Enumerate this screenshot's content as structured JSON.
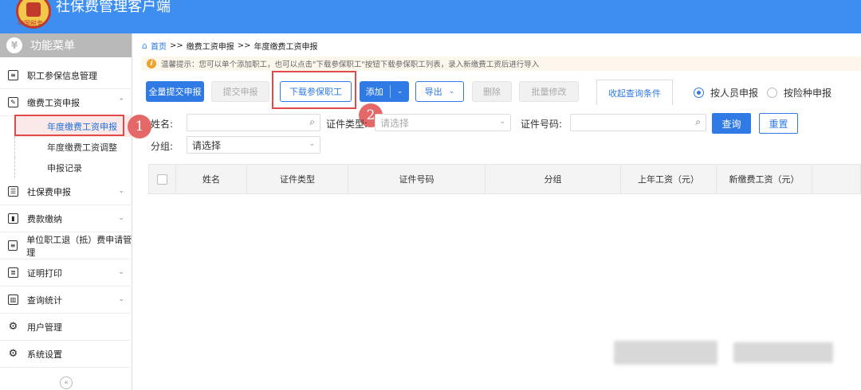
{
  "app": {
    "title": "社保费管理客户端",
    "logo_caption": "中国税务",
    "brand_color": "#3d8ef0"
  },
  "sidebar": {
    "header": "功能菜单",
    "header_icon": "yen-icon",
    "items": [
      {
        "label": "职工参保信息管理",
        "icon": "list-icon"
      },
      {
        "label": "缴费工资申报",
        "icon": "edit-icon",
        "expanded": true,
        "children": [
          {
            "label": "年度缴费工资申报",
            "active": true
          },
          {
            "label": "年度缴费工资调整"
          },
          {
            "label": "申报记录"
          }
        ]
      },
      {
        "label": "社保费申报",
        "icon": "form-icon"
      },
      {
        "label": "费款缴纳",
        "icon": "book-icon"
      },
      {
        "label": "单位职工退（抵）费申请管理",
        "icon": "list-icon"
      },
      {
        "label": "证明打印",
        "icon": "print-icon"
      },
      {
        "label": "查询统计",
        "icon": "chart-icon"
      },
      {
        "label": "用户管理",
        "icon": "gear-icon"
      },
      {
        "label": "系统设置",
        "icon": "gear-icon"
      }
    ],
    "collapse_label": "«"
  },
  "breadcrumb": {
    "home": "首页",
    "sep": ">>",
    "level1": "缴费工资申报",
    "level2": "年度缴费工资申报"
  },
  "tip": "温馨提示：您可以单个添加职工，也可以点击\"下载参保职工\"按钮下载参保职工列表，录入新缴费工资后进行导入",
  "toolbar": {
    "submit_all": "全量提交申报",
    "submit": "提交申报",
    "download": "下载参保职工",
    "add": "添加",
    "export": "导出",
    "delete": "删除",
    "batch_edit": "批量修改",
    "collapse_query": "收起查询条件",
    "radio_person": "按人员申报",
    "radio_insurance": "按险种申报"
  },
  "filters": {
    "name_label": "姓名:",
    "name_value": "",
    "id_type_label": "证件类型:",
    "id_type_placeholder": "请选择",
    "id_no_label": "证件号码:",
    "id_no_value": "",
    "query": "查询",
    "reset": "重置",
    "group_label": "分组:",
    "group_value": "请选择"
  },
  "table": {
    "columns": [
      "姓名",
      "证件类型",
      "证件号码",
      "分组",
      "上年工资（元）",
      "新缴费工资（元）"
    ],
    "rows": []
  },
  "annotations": {
    "step1": "1",
    "step2": "2",
    "highlight_color": "#e24a4a"
  }
}
